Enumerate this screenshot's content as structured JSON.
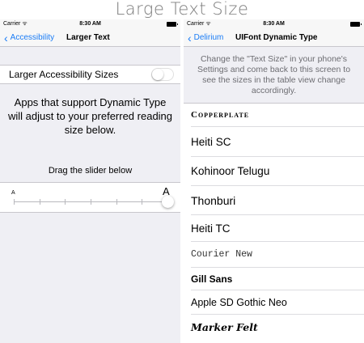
{
  "banner": {
    "title": "Large Text Size"
  },
  "left_phone": {
    "status": {
      "carrier": "Carrier",
      "wifi": "ᯤ",
      "time": "8:30 AM"
    },
    "nav": {
      "back_label": "Accessibility",
      "title": "Larger Text"
    },
    "toggle": {
      "label": "Larger Accessibility Sizes",
      "state": "off"
    },
    "description": "Apps that support Dynamic Type will adjust to your preferred reading size below.",
    "slider": {
      "hint": "Drag the slider below",
      "small_label": "A",
      "large_label": "A",
      "steps": 7,
      "value_step": 6
    }
  },
  "right_phone": {
    "status": {
      "carrier": "Carrier",
      "wifi": "ᯤ",
      "time": "8:30 AM"
    },
    "nav": {
      "back_label": "Delirium",
      "title": "UIFont Dynamic Type"
    },
    "header_text": "Change the \"Text Size\" in your phone's Settings and come back to this screen to see the sizes in the table view change accordingly.",
    "fonts": [
      {
        "name": "Copperplate"
      },
      {
        "name": "Heiti SC"
      },
      {
        "name": "Kohinoor Telugu"
      },
      {
        "name": "Thonburi"
      },
      {
        "name": "Heiti TC"
      },
      {
        "name": "Courier New"
      },
      {
        "name": "Gill Sans"
      },
      {
        "name": "Apple SD Gothic Neo"
      },
      {
        "name": "Marker Felt"
      }
    ]
  },
  "colors": {
    "accent": "#1a7cf6",
    "grouped_background": "#efeff4",
    "separator": "#c8c7cc",
    "header_text": "#6d6d72"
  }
}
